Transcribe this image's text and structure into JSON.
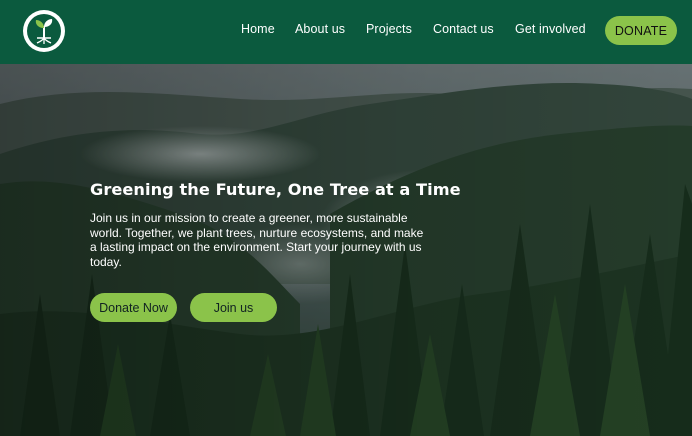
{
  "nav": {
    "logo_icon": "tree-sprout-icon",
    "links": [
      "Home",
      "About us",
      "Projects",
      "Contact us",
      "Get involved"
    ],
    "donate_label": "DONATE"
  },
  "hero": {
    "title": "Greening the Future, One Tree at a Time",
    "description": "Join us in our mission to create a greener, more sustainable world. Together, we plant trees, nurture ecosystems, and make a lasting impact on the environment. Start your journey with us today.",
    "primary_button": "Donate Now",
    "secondary_button": "Join us"
  },
  "colors": {
    "nav_bg": "#0b5a3e",
    "accent": "#8bc34a"
  }
}
